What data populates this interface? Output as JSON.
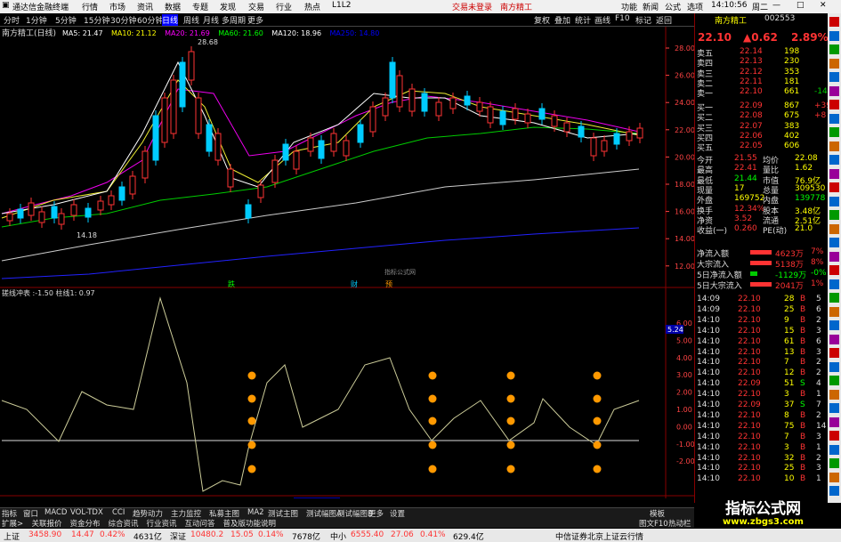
{
  "topbar": {
    "app_name": "通达信金融终端",
    "menus": [
      "行情",
      "市场",
      "资讯",
      "数据",
      "专题",
      "发现",
      "交易",
      "行业",
      "热点",
      "L1L2"
    ],
    "trade_status": "交易未登录",
    "stock_name": "南方精工",
    "right_items": [
      "功能",
      "新闻",
      "公式",
      "选项"
    ],
    "time": "14:10:56",
    "weekday": "周二"
  },
  "tabs": {
    "periods": [
      "分时",
      "1分钟",
      "5分钟",
      "15分钟",
      "30分钟",
      "60分钟",
      "日线",
      "周线",
      "月线",
      "多周期",
      "更多"
    ],
    "active": "日线"
  },
  "toolbar": {
    "buttons": [
      "复权",
      "叠加",
      "统计",
      "画线",
      "F10",
      "标记",
      "返回"
    ]
  },
  "chart": {
    "title": "南方精工(日线)",
    "ma_labels": [
      {
        "text": "MA5: 21.47",
        "color": "#ffffff"
      },
      {
        "text": "MA10: 21.12",
        "color": "#ffff00"
      },
      {
        "text": "MA20: 21.69",
        "color": "#ff00ff"
      },
      {
        "text": "MA60: 21.60",
        "color": "#00ff00"
      },
      {
        "text": "MA120: 18.96",
        "color": "#ffffff"
      },
      {
        "text": "MA250: 14.80",
        "color": "#0000ff"
      }
    ],
    "price_ticks": [
      "28.00",
      "26.00",
      "24.00",
      "22.00",
      "20.00",
      "18.00",
      "16.00",
      "14.00",
      "12.00"
    ],
    "high_label": "28.68",
    "low_label": "14.18",
    "watermark": "指标公式网",
    "markers": [
      "跌",
      "财",
      "预"
    ],
    "indicator_title": "搓线冲表 :-1.50  柱线1: 0.97",
    "ind_ticks": [
      "6.00",
      "5.00",
      "4.00",
      "3.00",
      "2.00",
      "1.00",
      "0.00",
      "-1.00",
      "-2.00"
    ],
    "ind_tag": "5.24",
    "date_labels": [
      "2025年",
      "3",
      "4",
      "2025/04/18/五",
      "5",
      "6",
      "7"
    ],
    "period_tag": "日线"
  },
  "quote": {
    "name": "南方精工",
    "code": "002553",
    "price": "22.10",
    "change": "▲0.62",
    "pct": "2.89%",
    "asks": [
      {
        "label": "卖五",
        "price": "22.14",
        "vol": "198"
      },
      {
        "label": "卖四",
        "price": "22.13",
        "vol": "230"
      },
      {
        "label": "卖三",
        "price": "22.12",
        "vol": "353"
      },
      {
        "label": "卖二",
        "price": "22.11",
        "vol": "181"
      },
      {
        "label": "卖一",
        "price": "22.10",
        "vol": "661",
        "chg": "-14"
      }
    ],
    "bids": [
      {
        "label": "买一",
        "price": "22.09",
        "vol": "867",
        "chg": "+39"
      },
      {
        "label": "买二",
        "price": "22.08",
        "vol": "675",
        "chg": "+8"
      },
      {
        "label": "买三",
        "price": "22.07",
        "vol": "383",
        "chg": ""
      },
      {
        "label": "买四",
        "price": "22.06",
        "vol": "402",
        "chg": ""
      },
      {
        "label": "买五",
        "price": "22.05",
        "vol": "606",
        "chg": ""
      }
    ],
    "stats": [
      [
        "今开",
        "21.55",
        "均价",
        "22.08"
      ],
      [
        "最高",
        "22.41",
        "量比",
        "1.62"
      ],
      [
        "最低",
        "21.44",
        "市值",
        "76.9亿"
      ],
      [
        "现量",
        "17",
        "总量",
        "309530"
      ],
      [
        "外盘",
        "169752",
        "内盘",
        "139778"
      ],
      [
        "换手",
        "12.34%",
        "股本",
        "3.48亿"
      ],
      [
        "净资",
        "3.52",
        "流通",
        "2.51亿"
      ],
      [
        "收益(一)",
        "0.260",
        "PE(动)",
        "21.0"
      ]
    ],
    "flows": [
      [
        "净流入额",
        "4623万",
        "7%"
      ],
      [
        "大宗流入",
        "5138万",
        "8%"
      ],
      [
        "5日净流入额",
        "-1129万",
        "-0%"
      ],
      [
        "5日大宗流入",
        "2041万",
        "1%"
      ]
    ],
    "ticks": [
      [
        "14:09",
        "22.10",
        "28",
        "B",
        "5"
      ],
      [
        "14:09",
        "22.10",
        "25",
        "B",
        "6"
      ],
      [
        "14:10",
        "22.10",
        "9",
        "B",
        "2"
      ],
      [
        "14:10",
        "22.10",
        "15",
        "B",
        "3"
      ],
      [
        "14:10",
        "22.10",
        "61",
        "B",
        "6"
      ],
      [
        "14:10",
        "22.10",
        "13",
        "B",
        "3"
      ],
      [
        "14:10",
        "22.10",
        "7",
        "B",
        "2"
      ],
      [
        "14:10",
        "22.10",
        "12",
        "B",
        "2"
      ],
      [
        "14:10",
        "22.09",
        "51",
        "S",
        "4"
      ],
      [
        "14:10",
        "22.10",
        "3",
        "B",
        "1"
      ],
      [
        "14:10",
        "22.09",
        "37",
        "S",
        "7"
      ],
      [
        "14:10",
        "22.10",
        "8",
        "B",
        "2"
      ],
      [
        "14:10",
        "22.10",
        "75",
        "B",
        "14"
      ],
      [
        "14:10",
        "22.10",
        "7",
        "B",
        "3"
      ],
      [
        "14:10",
        "22.10",
        "3",
        "B",
        "1"
      ],
      [
        "14:10",
        "22.10",
        "32",
        "B",
        "2"
      ],
      [
        "14:10",
        "22.10",
        "25",
        "B",
        "3"
      ],
      [
        "14:10",
        "22.10",
        "10",
        "B",
        "1"
      ]
    ]
  },
  "footer_tabs": [
    "指标",
    "窗口",
    "MACD",
    "VOL-TDX",
    "CCI",
    "趋势动力",
    "主力监控",
    "私募主图",
    "MA2",
    "测试主图",
    "测试幅图A",
    "测试幅图B",
    "更多",
    "设置"
  ],
  "footer_tabs2": [
    "扩展>",
    "关联报价",
    "资金分布",
    "综合资讯",
    "行业资讯",
    "互动问答",
    "普及版功能说明"
  ],
  "footer_right": [
    "模板",
    "图文F10",
    "热动栏"
  ],
  "status": {
    "sh_label": "上证",
    "sh_val": "3458.90",
    "sh_chg": "14.47",
    "sh_pct": "0.42%",
    "sh_amt": "4631亿",
    "sz_label": "深证",
    "sz_val": "10480.2",
    "sz_chg": "15.05",
    "sz_pct": "0.14%",
    "sz_amt": "7678亿",
    "zx_label": "中小",
    "zx_val": "6555.40",
    "zx_chg": "27.06",
    "zx_pct": "0.41%",
    "zx_amt": "629.4亿",
    "right": "中信证券北京上证云行情"
  },
  "brand": "指标公式网\nwww.zbgs3.com",
  "colors": {
    "up": "#ff3333",
    "down": "#00ffff",
    "ma5": "#ffffff",
    "ma10": "#ffff00",
    "ma20": "#ff00ff",
    "ma60": "#00ff00",
    "ma120": "#cccccc",
    "ma250": "#0000ff"
  }
}
